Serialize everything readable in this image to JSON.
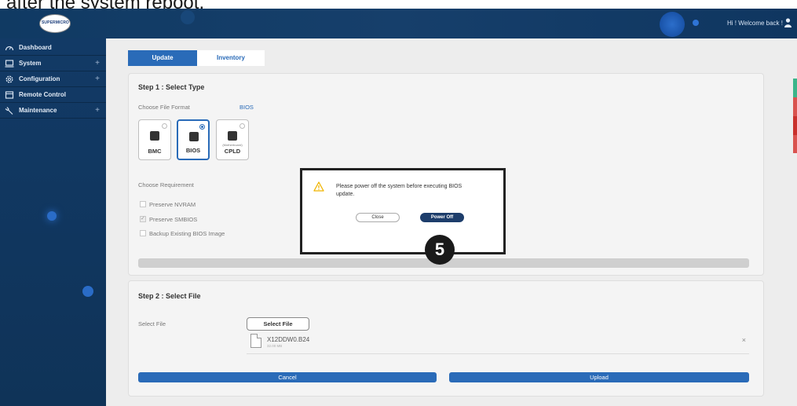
{
  "caption": "after the system reboot.",
  "header": {
    "logo_text": "SUPERMICRO",
    "welcome": "Hi ! Welcome back !"
  },
  "sidebar": {
    "items": [
      {
        "label": "Dashboard",
        "icon": "dashboard-icon",
        "expandable": false
      },
      {
        "label": "System",
        "icon": "monitor-icon",
        "expandable": true
      },
      {
        "label": "Configuration",
        "icon": "gear-icon",
        "expandable": true
      },
      {
        "label": "Remote Control",
        "icon": "window-icon",
        "expandable": false
      },
      {
        "label": "Maintenance",
        "icon": "wrench-icon",
        "expandable": true
      }
    ],
    "plus": "+"
  },
  "tabs": [
    {
      "label": "Update",
      "active": true
    },
    {
      "label": "Inventory",
      "active": false
    }
  ],
  "step1": {
    "title": "Step 1 : Select Type",
    "file_format_label": "Choose File Format",
    "file_format_value": "BIOS",
    "types": [
      {
        "label": "BMC",
        "sublabel": "",
        "selected": false
      },
      {
        "label": "BIOS",
        "sublabel": "",
        "selected": true
      },
      {
        "label": "CPLD",
        "sublabel": "(Motherboard)",
        "selected": false
      }
    ],
    "requirement_label": "Choose Requirement",
    "requirements": [
      {
        "label": "Preserve NVRAM",
        "checked": false
      },
      {
        "label": "Preserve SMBIOS",
        "checked": true
      },
      {
        "label": "Backup Existing BIOS Image",
        "checked": false
      }
    ]
  },
  "step2": {
    "title": "Step 2 : Select File",
    "select_file_label": "Select File",
    "select_file_button": "Select File",
    "file_name": "X12DDW0.B24",
    "file_size": "32.00 MB",
    "remove": "×",
    "cancel": "Cancel",
    "upload": "Upload"
  },
  "modal": {
    "message": "Please power off the system before executing BIOS update.",
    "close": "Close",
    "power_off": "Power Off"
  },
  "badge": "5",
  "colors": {
    "accent": "#2a6bb8",
    "header": "#163f6b",
    "sidebar": "#123a66",
    "power_off": "#1d3d6b",
    "warning": "#f0b400"
  }
}
